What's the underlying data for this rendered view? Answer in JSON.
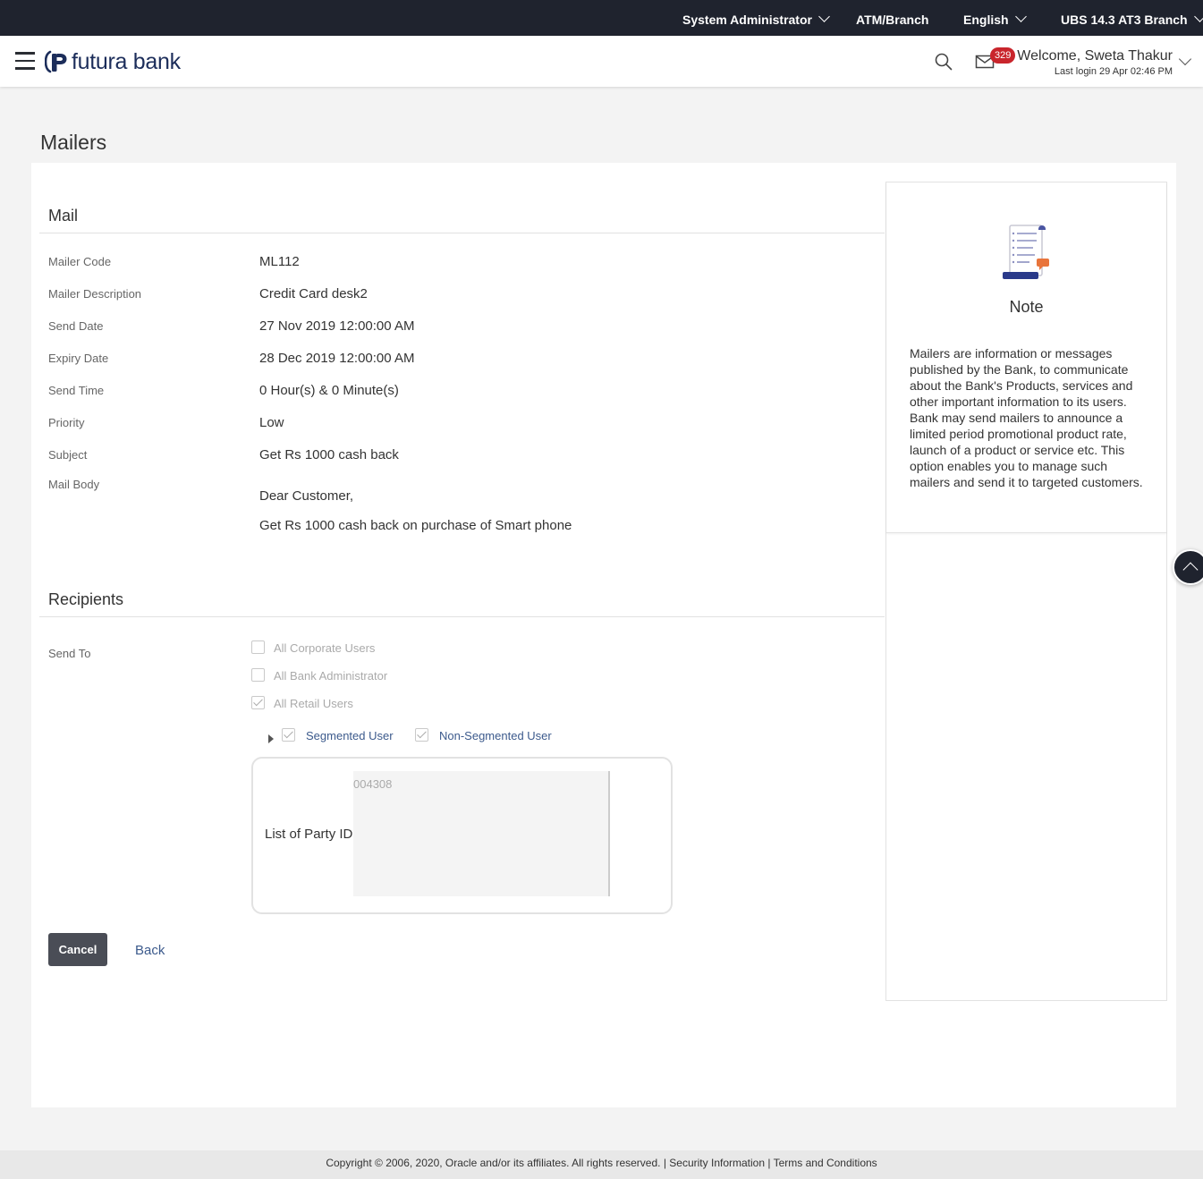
{
  "topbar": {
    "role": "System Administrator",
    "location": "ATM/Branch",
    "language": "English",
    "entity": "UBS 14.3 AT3 Branch"
  },
  "header": {
    "brand": "futura bank",
    "notification_count": "329",
    "welcome": "Welcome, Sweta Thakur",
    "last_login": "Last login 29 Apr 02:46 PM"
  },
  "page": {
    "title": "Mailers"
  },
  "mail": {
    "section_title": "Mail",
    "fields": [
      {
        "label": "Mailer Code",
        "value": "ML112"
      },
      {
        "label": "Mailer Description",
        "value": "Credit Card desk2"
      },
      {
        "label": "Send Date",
        "value": "27 Nov 2019 12:00:00 AM"
      },
      {
        "label": "Expiry Date",
        "value": "28 Dec 2019 12:00:00 AM"
      },
      {
        "label": "Send Time",
        "value": "0 Hour(s) & 0 Minute(s)"
      },
      {
        "label": "Priority",
        "value": "Low"
      },
      {
        "label": "Subject",
        "value": "Get Rs 1000 cash back"
      }
    ],
    "body_label": "Mail Body",
    "body_lines": [
      "Dear Customer,",
      "Get Rs 1000 cash back on purchase of Smart phone"
    ]
  },
  "recipients": {
    "section_title": "Recipients",
    "send_to_label": "Send To",
    "options": [
      {
        "label": "All Corporate Users",
        "checked": false
      },
      {
        "label": "All Bank Administrator",
        "checked": false
      },
      {
        "label": "All Retail Users",
        "checked": true
      }
    ],
    "segmented_label": "Segmented User",
    "non_segmented_label": "Non-Segmented User",
    "party_list_label": "List of Party ID",
    "party_ids": "004308"
  },
  "actions": {
    "cancel": "Cancel",
    "back": "Back"
  },
  "note": {
    "title": "Note",
    "text": "Mailers are information or messages published by the Bank, to communicate about the Bank's Products, services and other important information to its users. Bank may send mailers to announce a limited period promotional product rate, launch of a product or service etc. This option enables you to manage such mailers and send it to targeted customers."
  },
  "footer": {
    "copyright": "Copyright © 2006, 2020, Oracle and/or its affiliates. All rights reserved.",
    "separator": "|",
    "security": "Security Information",
    "terms": "Terms and Conditions"
  },
  "colors": {
    "topbar": "#1f232e",
    "brand": "#1c2d5a",
    "badge": "#c9252c",
    "link": "#3c5a8c",
    "button": "#4a4d56"
  }
}
